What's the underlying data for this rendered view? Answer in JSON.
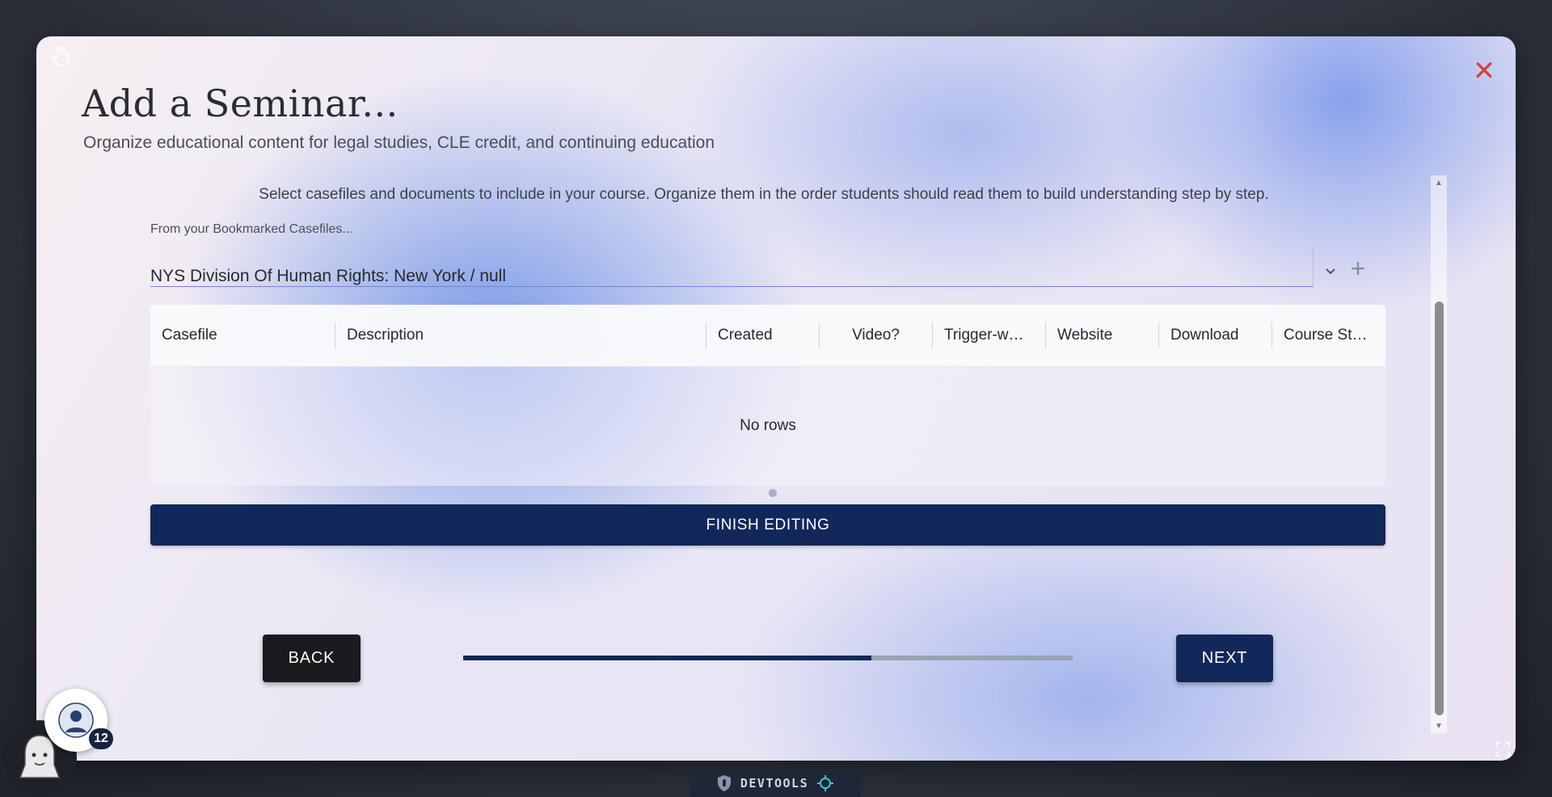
{
  "modal": {
    "title": "Add a Seminar...",
    "subtitle": "Organize educational content for legal studies, CLE credit, and continuing education",
    "close_icon": "close-icon"
  },
  "step": {
    "instruction": "Select casefiles and documents to include in your course. Organize them in the order students should read them to build understanding step by step.",
    "bookmark_label": "From your Bookmarked Casefiles...",
    "selected_casefile": "NYS Division Of Human Rights: New York / null",
    "grid": {
      "columns": [
        "Casefile",
        "Description",
        "Created",
        "Video?",
        "Trigger-w…",
        "Website",
        "Download",
        "Course St…"
      ],
      "empty_text": "No rows"
    },
    "finish_label": "FINISH EDITING"
  },
  "nav": {
    "back_label": "BACK",
    "next_label": "NEXT",
    "progress": 0.67
  },
  "overlay": {
    "notification_count": "12",
    "devtools_label": "DEVTOOLS"
  },
  "colors": {
    "primary": "#13285a",
    "close": "#d0453a"
  }
}
